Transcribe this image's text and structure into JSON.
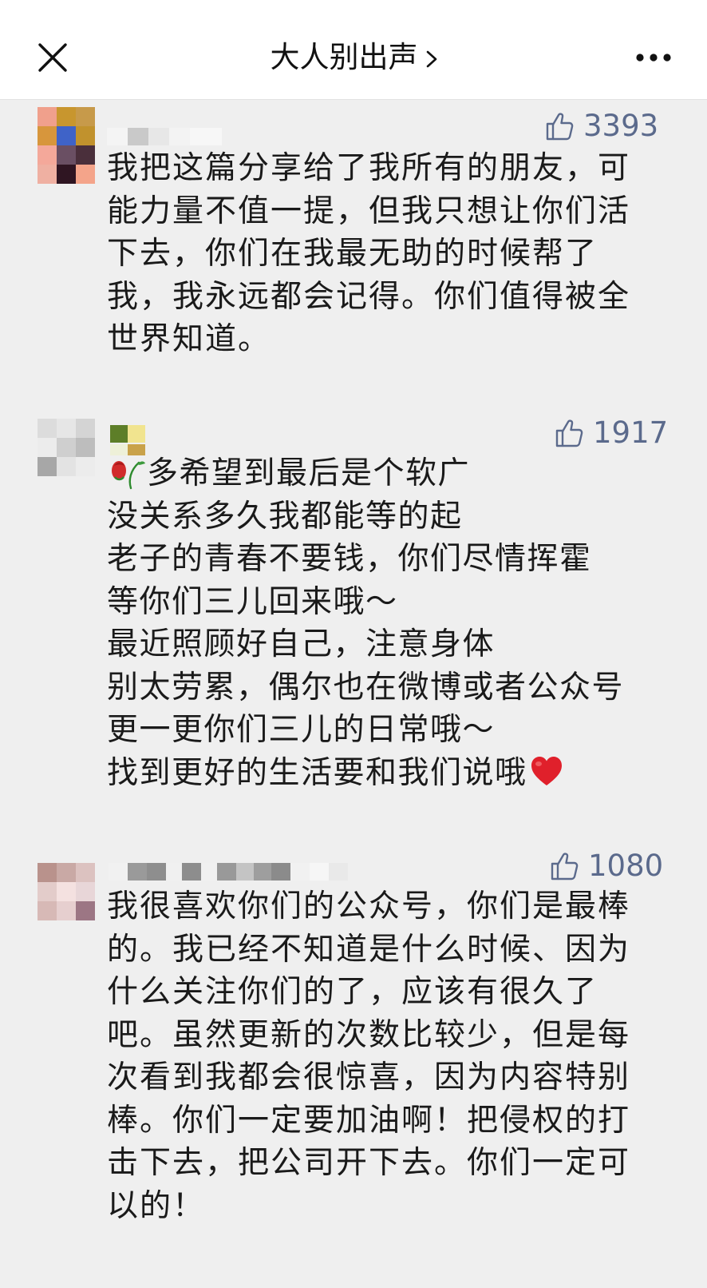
{
  "header": {
    "title": "大人别出声",
    "close_icon": "close-icon",
    "chevron_icon": "chevron-right-icon",
    "more_icon": "more-icon"
  },
  "colors": {
    "like_accent": "#5b6a8c",
    "background": "#efefef",
    "heart": "#e0202b"
  },
  "comments": [
    {
      "likes": "3393",
      "text": "我把这篇分享给了我所有的朋友，可\n能力量不值一提，但我只想让你们活\n下去，你们在我最无助的时候帮了\n我，我永远都会记得。你们值得被全\n世界知道。"
    },
    {
      "likes": "1917",
      "lead_emoji": "rose-icon",
      "first_line": "多希望到最后是个软广",
      "rest": "没关系多久我都能等的起\n老子的青春不要钱，你们尽情挥霍\n等你们三儿回来哦～\n最近照顾好自己，注意身体\n别太劳累，偶尔也在微博或者公众号\n更一更你们三儿的日常哦～",
      "last_line": "找到更好的生活要和我们说哦",
      "trail_emoji": "heart-icon"
    },
    {
      "likes": "1080",
      "text": "我很喜欢你们的公众号，你们是最棒\n的。我已经不知道是什么时候、因为\n什么关注你们的了，应该有很久了\n吧。虽然更新的次数比较少，但是每\n次看到我都会很惊喜，因为内容特别\n棒。你们一定要加油啊！把侵权的打\n击下去，把公司开下去。你们一定可\n以的！"
    }
  ]
}
